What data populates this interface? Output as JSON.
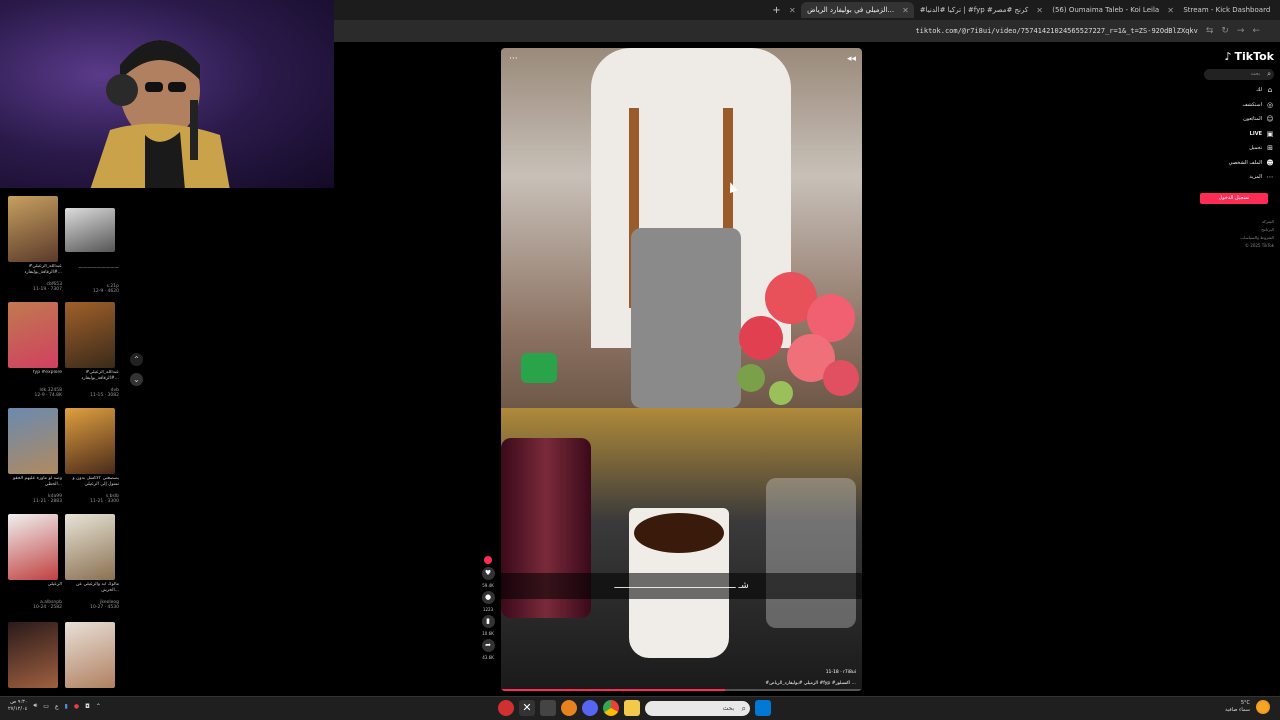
{
  "browser": {
    "tabs": [
      {
        "label": "الزميلي في بوليفارد الرياض...",
        "active": true
      },
      {
        "label": "#تركيا #الدنيا | #fyp #كرنج #مصر",
        "active": false
      },
      {
        "label": "(56) Oumaima Taleb - Koi Leila",
        "active": false
      },
      {
        "label": "Stream - Kick Dashboard",
        "active": false
      }
    ],
    "new_tab": "+",
    "url": "tiktok.com/@r7i8ui/video/75741421024565527227_r=1&_t=ZS-92OdBlZXqkv"
  },
  "profile_grid": {
    "items": [
      {
        "caption": "#عبدالله_الزعيلي #الزقافة_بوليفارد...",
        "user": "cbf653",
        "stats": "11-19 · 7307"
      },
      {
        "caption": "—————————",
        "user": "s.21p",
        "stats": "12-9 · 4620"
      },
      {
        "caption": "fyp #explore",
        "user": "ldk.32458",
        "stats": "12-9 · 74.8K"
      },
      {
        "caption": "#عبدالله_الزعيلي #الزقافة_بوليفارد...",
        "user": "dvb",
        "stats": "11-15 · 3082"
      },
      {
        "caption": "وصد لو ماوره عليهم الحقو الحظي...",
        "user": "kda99",
        "stats": "11-21 · 2883"
      },
      {
        "caption": "يصصغني 'الاكسل بدون و تسول إلى الزعيلي",
        "user": "s.bslb",
        "stats": "11-21 · 3300"
      },
      {
        "caption": "الزعيلي",
        "user": "a.albsnpb",
        "stats": "10-24 · 2582"
      },
      {
        "caption": "مالوك ابد والزعيلي عن الخرش...",
        "user": "jkeoleog",
        "stats": "10-27 · 4530"
      },
      {
        "caption": "",
        "user": "",
        "stats": ""
      },
      {
        "caption": "",
        "user": "",
        "stats": ""
      }
    ]
  },
  "video": {
    "subtitle": "ﺷـ ــــــــــــــــــــــــــــــــــــــــــــــ",
    "date": "11-18",
    "author": "r7i8ui",
    "caption": "#الزميلي #بوليفارد_الرياض #fyp #اكسبلور ...",
    "progress": 0.62,
    "more": "···"
  },
  "actions": {
    "likes": "59.4K",
    "comments": "1223",
    "saves": "10.6K",
    "shares": "43.6K"
  },
  "tiktok": {
    "brand": "TikTok",
    "search_placeholder": "بحث",
    "nav": [
      {
        "label": "لك",
        "icon": "home-icon"
      },
      {
        "label": "استكشف",
        "icon": "compass-icon"
      },
      {
        "label": "المتابَعون",
        "icon": "user-icon"
      },
      {
        "label": "LIVE",
        "icon": "live-icon"
      },
      {
        "label": "تحميل",
        "icon": "upload-icon"
      },
      {
        "label": "الملف الشخصي",
        "icon": "profile-icon"
      },
      {
        "label": "المزيد",
        "icon": "more-icon"
      }
    ],
    "login": "تسجيل الدخول",
    "footer": [
      "الشركة",
      "البرنامج",
      "الشروط والسياسات",
      "© 2025 TikTok"
    ]
  },
  "taskbar": {
    "time": "٩:٣٠ ص",
    "date": "٢٧/١٢/٠٤",
    "search_placeholder": "بحث",
    "weather_temp": "5°C",
    "weather_desc": "سماء صافية"
  }
}
